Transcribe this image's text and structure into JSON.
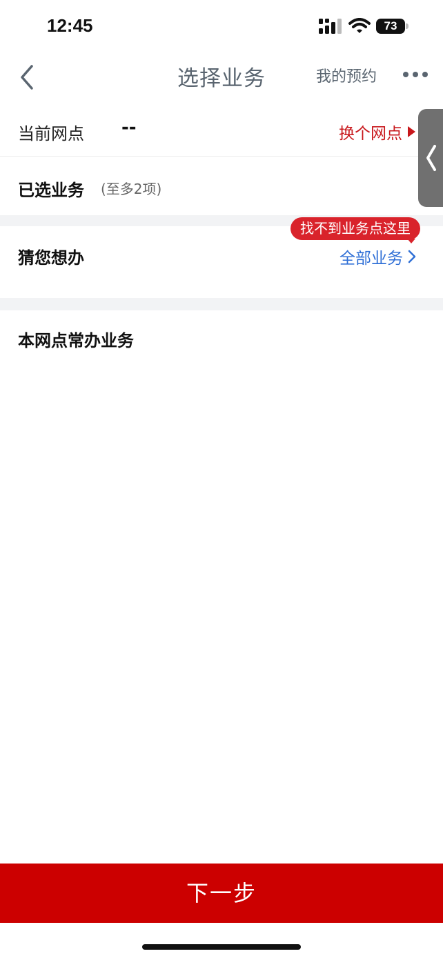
{
  "status_bar": {
    "time": "12:45",
    "battery": "73"
  },
  "nav": {
    "title": "选择业务",
    "my_booking": "我的预约"
  },
  "branch": {
    "label": "当前网点",
    "value": "--",
    "change": "换个网点"
  },
  "selected": {
    "label": "已选业务",
    "hint": "(至多2项)"
  },
  "guess": {
    "label": "猜您想办",
    "all_services": "全部业务",
    "tooltip": "找不到业务点这里"
  },
  "common": {
    "label": "本网点常办业务"
  },
  "footer": {
    "next": "下一步"
  },
  "colors": {
    "accent_red": "#cc0000",
    "link_blue": "#2f6fd6",
    "nav_gray": "#5a6570"
  },
  "icons": {
    "back": "chevron-left-icon",
    "more": "more-dots-icon",
    "handle": "chevron-left-icon",
    "arrow": "chevron-right-icon"
  }
}
